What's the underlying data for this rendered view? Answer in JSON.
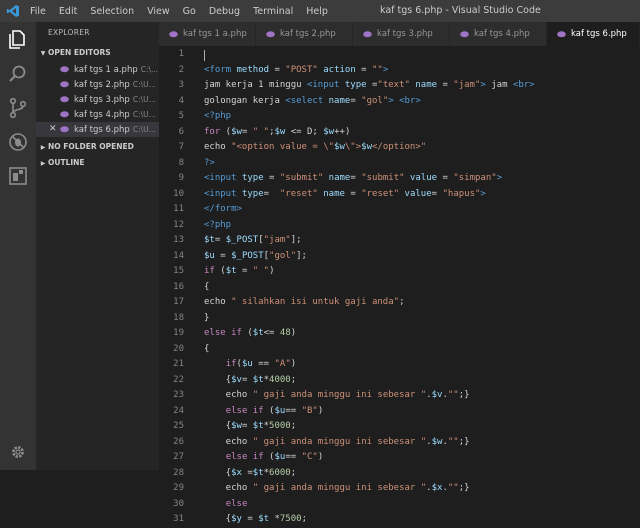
{
  "titlebar": {
    "menu": [
      "File",
      "Edit",
      "Selection",
      "View",
      "Go",
      "Debug",
      "Terminal",
      "Help"
    ],
    "window_title": "kaf tgs 6.php - Visual Studio Code"
  },
  "activity_icons": [
    "files-icon",
    "search-icon",
    "source-control-icon",
    "debug-icon",
    "extensions-icon"
  ],
  "sidebar": {
    "title": "EXPLORER",
    "open_editors_label": "OPEN EDITORS",
    "no_folder_label": "NO FOLDER OPENED",
    "outline_label": "OUTLINE",
    "files": [
      {
        "name": "kaf tgs 1 a.php",
        "path": "C:\\...",
        "active": false
      },
      {
        "name": "kaf tgs 2.php",
        "path": "C:\\U...",
        "active": false
      },
      {
        "name": "kaf tgs 3.php",
        "path": "C:\\U...",
        "active": false
      },
      {
        "name": "kaf tgs 4.php",
        "path": "C:\\U...",
        "active": false
      },
      {
        "name": "kaf tgs 6.php",
        "path": "C:\\U...",
        "active": true
      }
    ]
  },
  "tabs": [
    {
      "label": "kaf tgs 1 a.php",
      "active": false
    },
    {
      "label": "kaf tgs 2.php",
      "active": false
    },
    {
      "label": "kaf tgs 3.php",
      "active": false
    },
    {
      "label": "kaf tgs 4.php",
      "active": false
    },
    {
      "label": "kaf tgs 6.php",
      "active": true
    }
  ],
  "colors": {
    "tag": "#569cd6",
    "attr": "#9cdcfe",
    "string": "#ce9178",
    "keyword": "#c586c0",
    "variable": "#9cdcfe",
    "number": "#b5cea8",
    "text": "#d4d4d4",
    "php": "#569cd6",
    "func": "#dcdcaa"
  },
  "code_lines": [
    {
      "n": "1",
      "t": []
    },
    {
      "n": "2",
      "t": [
        [
          "<form ",
          "tag"
        ],
        [
          "method",
          "attr"
        ],
        [
          " = ",
          "text"
        ],
        [
          "\"POST\"",
          "string"
        ],
        [
          " action",
          "attr"
        ],
        [
          " = ",
          "text"
        ],
        [
          "\"\"",
          "string"
        ],
        [
          ">",
          "tag"
        ]
      ]
    },
    {
      "n": "3",
      "t": [
        [
          "jam kerja 1 minggu ",
          "text"
        ],
        [
          "<input ",
          "tag"
        ],
        [
          "type",
          "attr"
        ],
        [
          " =",
          "text"
        ],
        [
          "\"text\"",
          "string"
        ],
        [
          " name",
          "attr"
        ],
        [
          " = ",
          "text"
        ],
        [
          "\"jam\"",
          "string"
        ],
        [
          ">",
          "tag"
        ],
        [
          " jam ",
          "text"
        ],
        [
          "<br>",
          "tag"
        ]
      ]
    },
    {
      "n": "4",
      "t": [
        [
          "golongan kerja ",
          "text"
        ],
        [
          "<select ",
          "tag"
        ],
        [
          "name",
          "attr"
        ],
        [
          "= ",
          "text"
        ],
        [
          "\"gol\"",
          "string"
        ],
        [
          ">",
          "tag"
        ],
        [
          " ",
          "text"
        ],
        [
          "<br>",
          "tag"
        ]
      ]
    },
    {
      "n": "5",
      "t": [
        [
          "<?php",
          "php"
        ]
      ]
    },
    {
      "n": "6",
      "t": [
        [
          "for",
          "keyword"
        ],
        [
          " (",
          "text"
        ],
        [
          "$w",
          "variable"
        ],
        [
          "= ",
          "text"
        ],
        [
          "\" \"",
          "string"
        ],
        [
          ";",
          "text"
        ],
        [
          "$w",
          "variable"
        ],
        [
          " <= D; ",
          "text"
        ],
        [
          "$w",
          "variable"
        ],
        [
          "++)",
          "text"
        ]
      ]
    },
    {
      "n": "7",
      "t": [
        [
          "echo ",
          "text"
        ],
        [
          "\"<option value = \\\"",
          "string"
        ],
        [
          "$w",
          "variable"
        ],
        [
          "\\\">",
          "string"
        ],
        [
          "$w",
          "variable"
        ],
        [
          "</option>\"",
          "string"
        ]
      ]
    },
    {
      "n": "8",
      "t": [
        [
          "?>",
          "php"
        ]
      ]
    },
    {
      "n": "9",
      "t": [
        [
          "<input ",
          "tag"
        ],
        [
          "type",
          "attr"
        ],
        [
          " = ",
          "text"
        ],
        [
          "\"submit\"",
          "string"
        ],
        [
          " name",
          "attr"
        ],
        [
          "= ",
          "text"
        ],
        [
          "\"submit\"",
          "string"
        ],
        [
          " value",
          "attr"
        ],
        [
          " = ",
          "text"
        ],
        [
          "\"simpan\"",
          "string"
        ],
        [
          ">",
          "tag"
        ]
      ]
    },
    {
      "n": "10",
      "t": [
        [
          "<input ",
          "tag"
        ],
        [
          "type",
          "attr"
        ],
        [
          "=  ",
          "text"
        ],
        [
          "\"reset\"",
          "string"
        ],
        [
          " name",
          "attr"
        ],
        [
          " = ",
          "text"
        ],
        [
          "\"reset\"",
          "string"
        ],
        [
          " value",
          "attr"
        ],
        [
          "= ",
          "text"
        ],
        [
          "\"hapus\"",
          "string"
        ],
        [
          ">",
          "tag"
        ]
      ]
    },
    {
      "n": "11",
      "t": [
        [
          "</form>",
          "tag"
        ]
      ]
    },
    {
      "n": "12",
      "t": [
        [
          "<?php",
          "php"
        ]
      ]
    },
    {
      "n": "13",
      "t": [
        [
          "$t",
          "variable"
        ],
        [
          "= ",
          "text"
        ],
        [
          "$_POST",
          "variable"
        ],
        [
          "[",
          "text"
        ],
        [
          "\"jam\"",
          "string"
        ],
        [
          "];",
          "text"
        ]
      ]
    },
    {
      "n": "14",
      "t": [
        [
          "$u",
          "variable"
        ],
        [
          " = ",
          "text"
        ],
        [
          "$_POST",
          "variable"
        ],
        [
          "[",
          "text"
        ],
        [
          "\"gol\"",
          "string"
        ],
        [
          "];",
          "text"
        ]
      ]
    },
    {
      "n": "15",
      "t": [
        [
          "if",
          "keyword"
        ],
        [
          " (",
          "text"
        ],
        [
          "$t",
          "variable"
        ],
        [
          " = ",
          "text"
        ],
        [
          "\" \"",
          "string"
        ],
        [
          ")",
          "text"
        ]
      ]
    },
    {
      "n": "16",
      "t": [
        [
          "{",
          "text"
        ]
      ]
    },
    {
      "n": "17",
      "t": [
        [
          "echo ",
          "text"
        ],
        [
          "\" silahkan isi untuk gaji anda\"",
          "string"
        ],
        [
          ";",
          "text"
        ]
      ]
    },
    {
      "n": "18",
      "t": [
        [
          "}",
          "text"
        ]
      ]
    },
    {
      "n": "19",
      "t": [
        [
          "else",
          "keyword"
        ],
        [
          " ",
          "text"
        ],
        [
          "if",
          "keyword"
        ],
        [
          " (",
          "text"
        ],
        [
          "$t",
          "variable"
        ],
        [
          "<= ",
          "text"
        ],
        [
          "48",
          "number"
        ],
        [
          ")",
          "text"
        ]
      ]
    },
    {
      "n": "20",
      "t": [
        [
          "{",
          "text"
        ]
      ]
    },
    {
      "n": "21",
      "t": [
        [
          "    ",
          "text"
        ],
        [
          "if",
          "keyword"
        ],
        [
          "(",
          "text"
        ],
        [
          "$u",
          "variable"
        ],
        [
          " == ",
          "text"
        ],
        [
          "\"A\"",
          "string"
        ],
        [
          ")",
          "text"
        ]
      ]
    },
    {
      "n": "22",
      "t": [
        [
          "    {",
          "text"
        ],
        [
          "$v",
          "variable"
        ],
        [
          "= ",
          "text"
        ],
        [
          "$t",
          "variable"
        ],
        [
          "*",
          "text"
        ],
        [
          "4000",
          "number"
        ],
        [
          ";",
          "text"
        ]
      ]
    },
    {
      "n": "23",
      "t": [
        [
          "    echo ",
          "text"
        ],
        [
          "\" gaji anda minggu ini sebesar \"",
          "string"
        ],
        [
          ".",
          "text"
        ],
        [
          "$v",
          "variable"
        ],
        [
          ".",
          "text"
        ],
        [
          "\"\"",
          "string"
        ],
        [
          ";}",
          "text"
        ]
      ]
    },
    {
      "n": "24",
      "t": [
        [
          "    ",
          "text"
        ],
        [
          "else",
          "keyword"
        ],
        [
          " ",
          "text"
        ],
        [
          "if",
          "keyword"
        ],
        [
          " (",
          "text"
        ],
        [
          "$u",
          "variable"
        ],
        [
          "== ",
          "text"
        ],
        [
          "\"B\"",
          "string"
        ],
        [
          ")",
          "text"
        ]
      ]
    },
    {
      "n": "25",
      "t": [
        [
          "    {",
          "text"
        ],
        [
          "$w",
          "variable"
        ],
        [
          "= ",
          "text"
        ],
        [
          "$t",
          "variable"
        ],
        [
          "*",
          "text"
        ],
        [
          "5000",
          "number"
        ],
        [
          ";",
          "text"
        ]
      ]
    },
    {
      "n": "26",
      "t": [
        [
          "    echo ",
          "text"
        ],
        [
          "\" gaji anda minggu ini sebesar \"",
          "string"
        ],
        [
          ".",
          "text"
        ],
        [
          "$w",
          "variable"
        ],
        [
          ".",
          "text"
        ],
        [
          "\"\"",
          "string"
        ],
        [
          ";}",
          "text"
        ]
      ]
    },
    {
      "n": "27",
      "t": [
        [
          "    ",
          "text"
        ],
        [
          "else",
          "keyword"
        ],
        [
          " ",
          "text"
        ],
        [
          "if",
          "keyword"
        ],
        [
          " (",
          "text"
        ],
        [
          "$u",
          "variable"
        ],
        [
          "== ",
          "text"
        ],
        [
          "\"C\"",
          "string"
        ],
        [
          ")",
          "text"
        ]
      ]
    },
    {
      "n": "28",
      "t": [
        [
          "    {",
          "text"
        ],
        [
          "$x",
          "variable"
        ],
        [
          " =",
          "text"
        ],
        [
          "$t",
          "variable"
        ],
        [
          "*",
          "text"
        ],
        [
          "6000",
          "number"
        ],
        [
          ";",
          "text"
        ]
      ]
    },
    {
      "n": "29",
      "t": [
        [
          "    echo ",
          "text"
        ],
        [
          "\" gaji anda minggu ini sebesar \"",
          "string"
        ],
        [
          ".",
          "text"
        ],
        [
          "$x",
          "variable"
        ],
        [
          ".",
          "text"
        ],
        [
          "\"\"",
          "string"
        ],
        [
          ";}",
          "text"
        ]
      ]
    },
    {
      "n": "30",
      "t": [
        [
          "    ",
          "text"
        ],
        [
          "else",
          "keyword"
        ]
      ]
    },
    {
      "n": "31",
      "t": [
        [
          "    {",
          "text"
        ],
        [
          "$y",
          "variable"
        ],
        [
          " = ",
          "text"
        ],
        [
          "$t",
          "variable"
        ],
        [
          " *",
          "text"
        ],
        [
          "7500",
          "number"
        ],
        [
          ";",
          "text"
        ]
      ]
    }
  ]
}
